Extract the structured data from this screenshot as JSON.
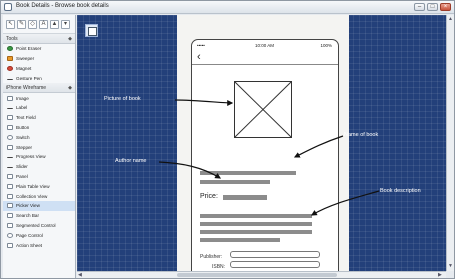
{
  "window": {
    "title": "Book Details - Browse book details"
  },
  "sidebar": {
    "tools_header": "Tools",
    "tools": [
      {
        "label": "Point Eraser",
        "icon": "green-eraser-icon"
      },
      {
        "label": "Sweeper",
        "icon": "broom-icon"
      },
      {
        "label": "Magnet",
        "icon": "magnet-icon"
      },
      {
        "label": "Gesture Pen",
        "icon": "pen-icon"
      }
    ],
    "stencil_header": "iPhone Wireframe",
    "stencils": [
      "Image",
      "Label",
      "Text Field",
      "Button",
      "Switch",
      "Stepper",
      "Progress View",
      "Slider",
      "Panel",
      "Plain Table View",
      "Collection View",
      "Picker View",
      "Search Bar",
      "Segmented Control",
      "Page Control",
      "Action Sheet"
    ]
  },
  "phone": {
    "carrier": "•••••",
    "time": "10:00 AM",
    "battery": "100%",
    "price_label": "Price:",
    "publisher_label": "Publisher:",
    "isbn_label": "ISBN:"
  },
  "annotations": {
    "picture": "Picture of book",
    "name": "Name of book",
    "author": "Author name",
    "description": "Book description"
  },
  "colors": {
    "canvas": "#23407a",
    "accent": "#d84a3a"
  }
}
